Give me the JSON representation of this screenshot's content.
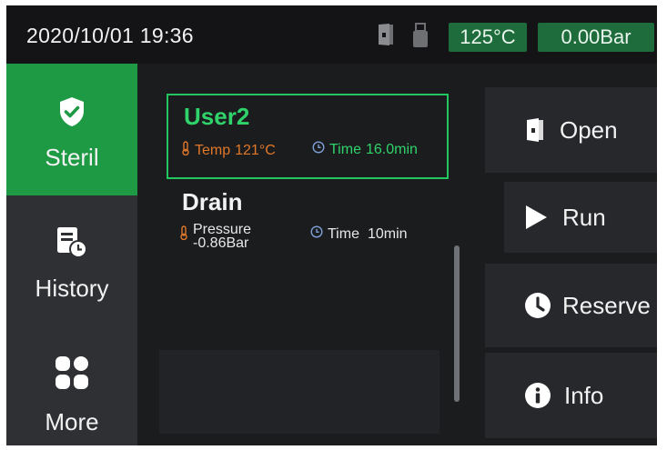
{
  "status_bar": {
    "datetime": "2020/10/01  19:36",
    "temperature": "125°C",
    "pressure": "0.00Bar",
    "icons": [
      "door-icon",
      "usb-icon"
    ],
    "badge_color": "#1e6b3b"
  },
  "sidebar": {
    "items": [
      {
        "label": "Steril",
        "icon": "shield-check-icon",
        "active": true
      },
      {
        "label": "History",
        "icon": "history-icon",
        "active": false
      },
      {
        "label": "More",
        "icon": "apps-grid-icon",
        "active": false
      }
    ],
    "active_color": "#1f9a44"
  },
  "programs": [
    {
      "name": "User2",
      "selected": true,
      "temp_label": "Temp",
      "temp_value": "121°C",
      "time_label": "Time",
      "time_value": "16.0min"
    },
    {
      "name": "Drain",
      "selected": false,
      "pressure_label": "Pressure",
      "pressure_value": "-0.86Bar",
      "time_label": "Time",
      "time_value": "10min"
    }
  ],
  "actions": [
    {
      "label": "Open",
      "icon": "door-icon"
    },
    {
      "label": "Run",
      "icon": "play-icon"
    },
    {
      "label": "Reserve",
      "icon": "clock-icon"
    },
    {
      "label": "Info",
      "icon": "info-icon"
    }
  ],
  "colors": {
    "accent_green": "#22c55e",
    "temp_orange": "#e0782a",
    "time_blue": "#7fa0d6"
  }
}
